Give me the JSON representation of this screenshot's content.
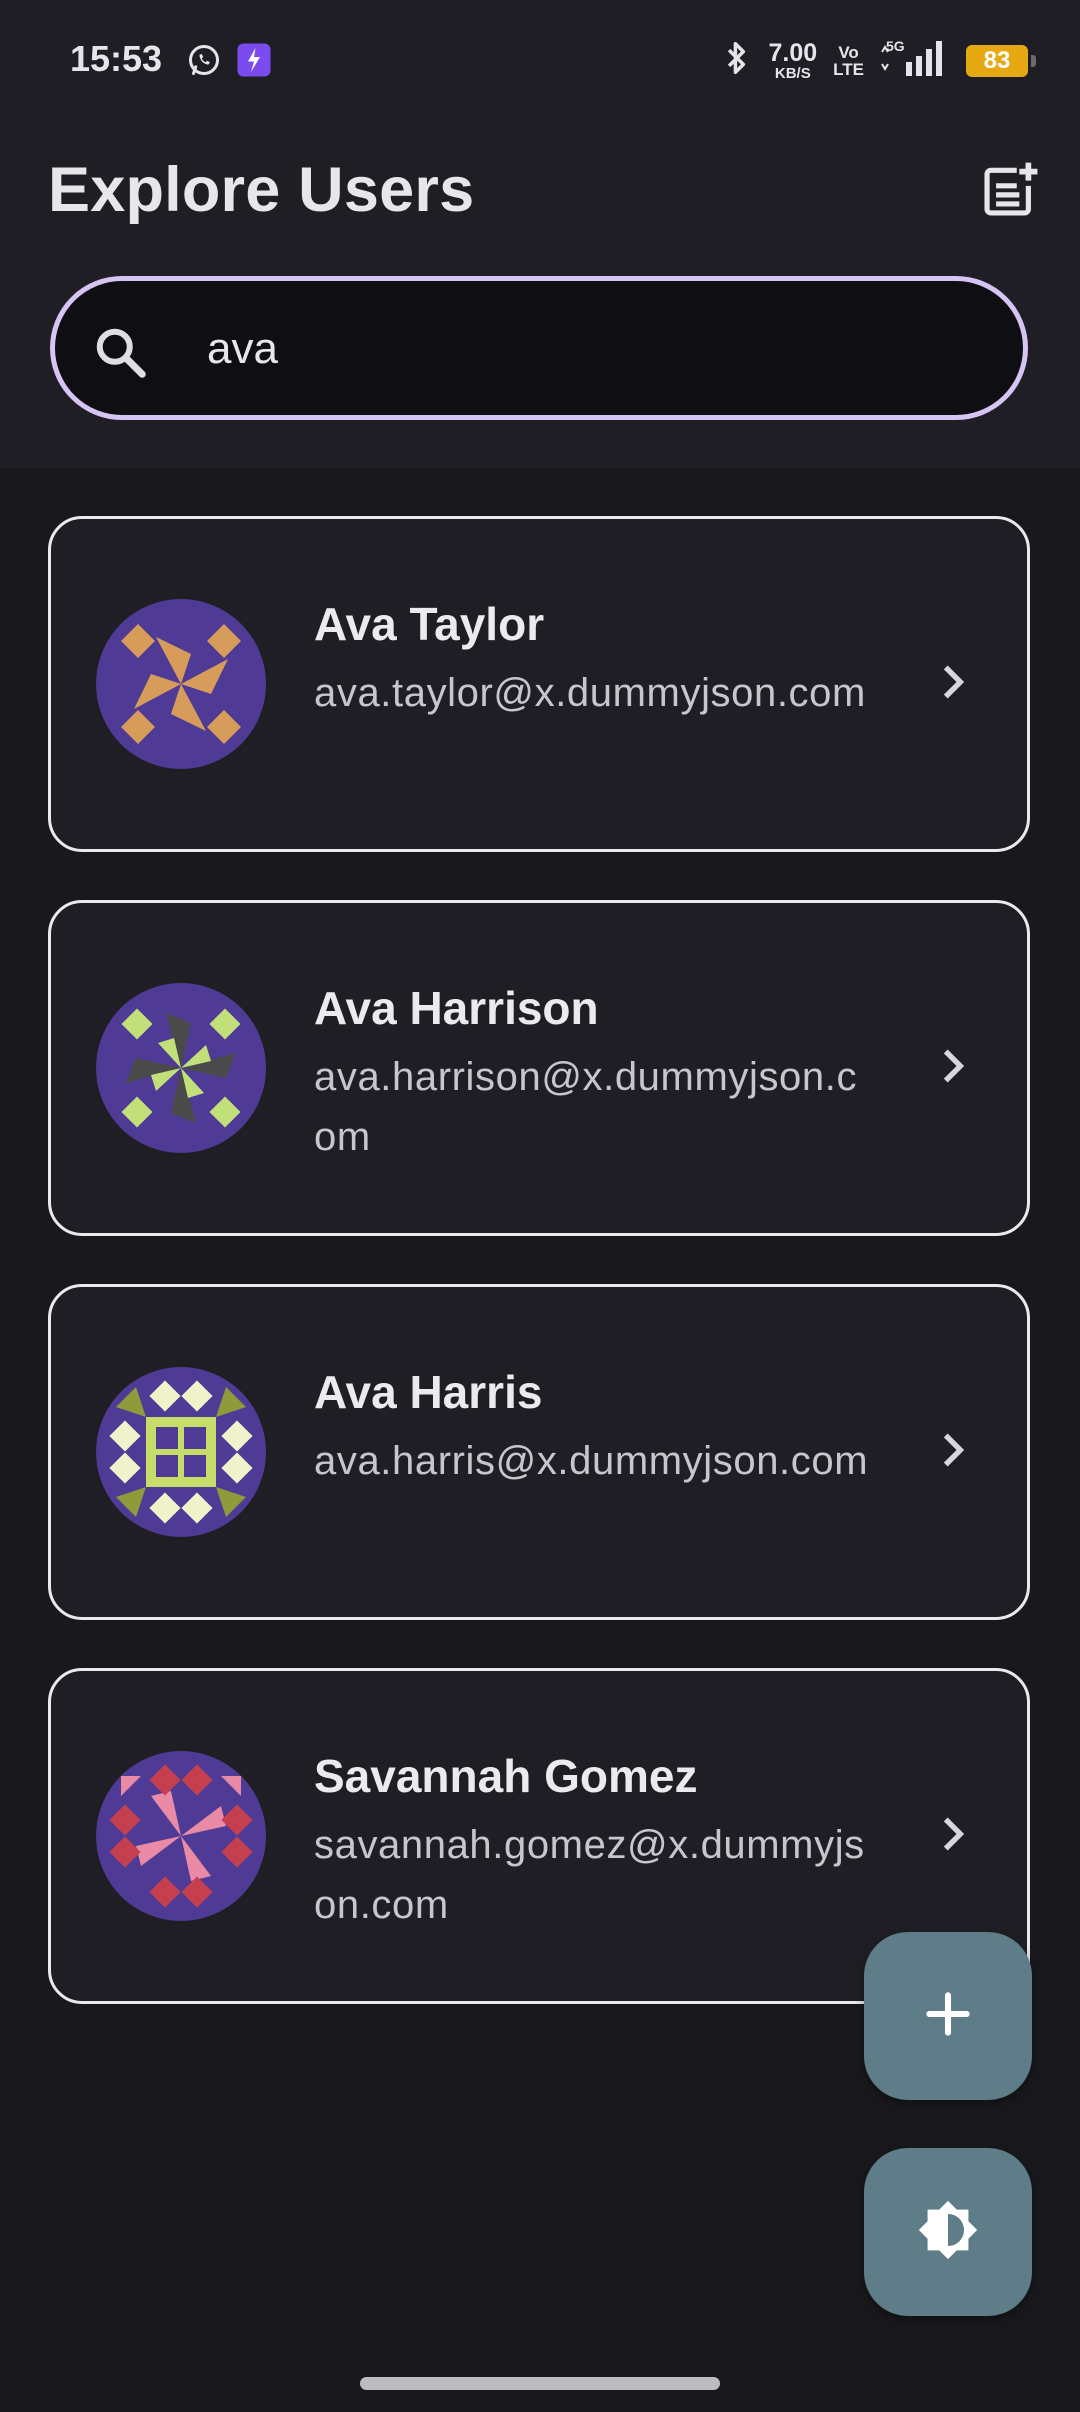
{
  "status_bar": {
    "time": "15:53",
    "speed_value": "7.00",
    "speed_unit": "KB/S",
    "volte_top": "Vo",
    "volte_bottom": "LTE",
    "network": "5G",
    "battery": "83"
  },
  "header": {
    "title": "Explore Users",
    "action_icon": "note-add-icon"
  },
  "search": {
    "value": "ava",
    "icon": "search-icon"
  },
  "users": [
    {
      "name": "Ava Taylor",
      "email": "ava.taylor@x.dummyjson.com",
      "avatar_colors": {
        "bg": "#4f3b96",
        "fg": "#d89c5a"
      }
    },
    {
      "name": "Ava Harrison",
      "email": "ava.harrison@x.dummyjson.com",
      "avatar_colors": {
        "bg": "#4f3b96",
        "fg": "#c2e07a",
        "fg2": "#4a4a4a"
      }
    },
    {
      "name": "Ava Harris",
      "email": "ava.harris@x.dummyjson.com",
      "avatar_colors": {
        "bg": "#4f3b96",
        "fg": "#c6dd6a",
        "fg2": "#eef3c9",
        "fg3": "#8f9a3a"
      }
    },
    {
      "name": "Savannah Gomez",
      "email": "savannah.gomez@x.dummyjson.com",
      "avatar_colors": {
        "bg": "#4f3b96",
        "fg": "#c63f4f",
        "fg2": "#e98aa6"
      }
    }
  ],
  "fabs": {
    "add_icon": "add-icon",
    "theme_icon": "brightness-toggle-icon",
    "color": "#5f7d88"
  },
  "theme": {
    "background": "#19181c",
    "surface": "#1f1e24",
    "accent": "#d6c4f4"
  }
}
